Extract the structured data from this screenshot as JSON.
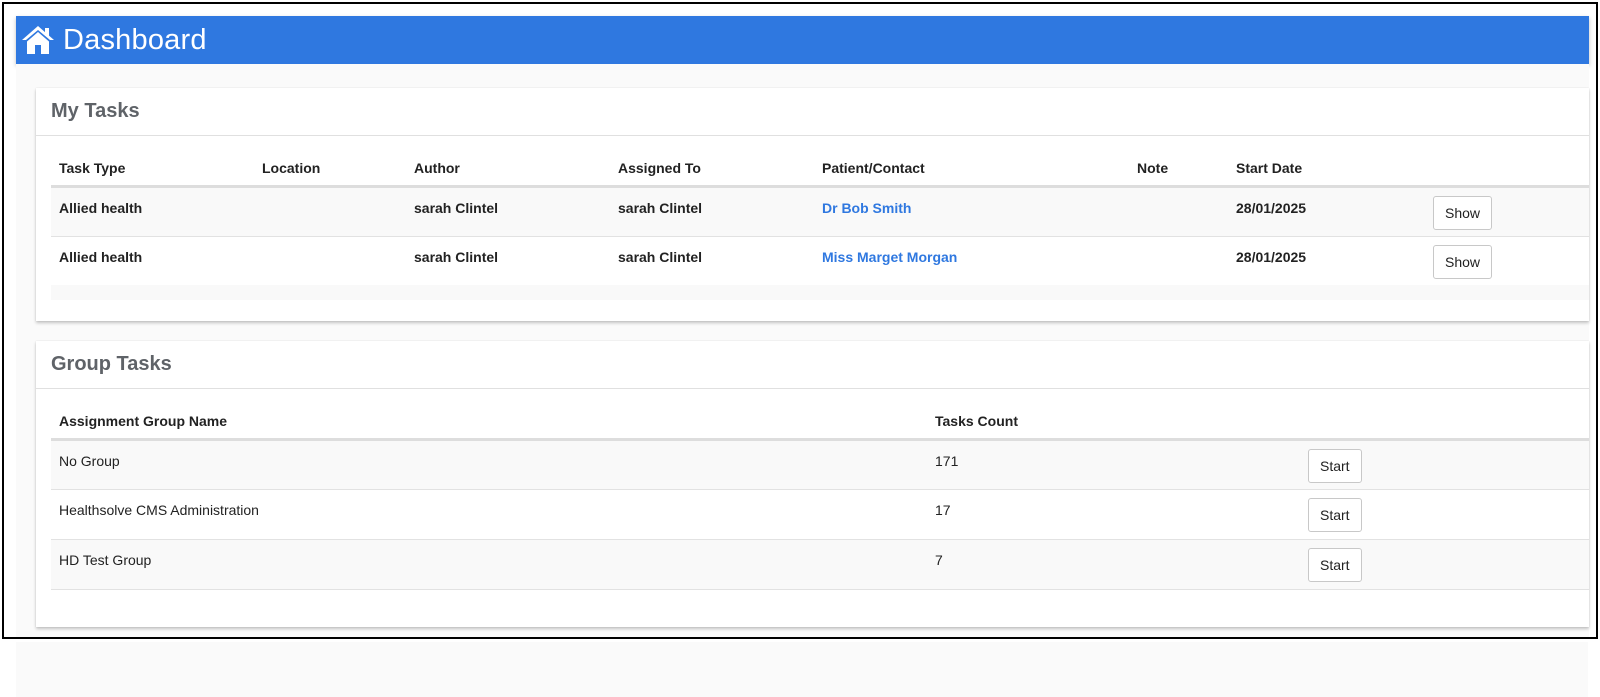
{
  "header": {
    "title": "Dashboard",
    "icon": "home-icon"
  },
  "my_tasks": {
    "title": "My Tasks",
    "columns": [
      "Task Type",
      "Location",
      "Author",
      "Assigned To",
      "Patient/Contact",
      "Note",
      "Start Date",
      ""
    ],
    "rows": [
      {
        "task_type": "Allied health",
        "location": "",
        "author": "sarah Clintel",
        "assigned_to": "sarah Clintel",
        "patient": "Dr Bob Smith",
        "note": "",
        "start_date": "28/01/2025",
        "action": "Show"
      },
      {
        "task_type": "Allied health",
        "location": "",
        "author": "sarah Clintel",
        "assigned_to": "sarah Clintel",
        "patient": "Miss Marget Morgan",
        "note": "",
        "start_date": "28/01/2025",
        "action": "Show"
      }
    ]
  },
  "group_tasks": {
    "title": "Group Tasks",
    "columns": [
      "Assignment Group Name",
      "Tasks Count",
      ""
    ],
    "rows": [
      {
        "name": "No Group",
        "count": "171",
        "action": "Start"
      },
      {
        "name": "Healthsolve CMS Administration",
        "count": "17",
        "action": "Start"
      },
      {
        "name": "HD Test Group",
        "count": "7",
        "action": "Start"
      }
    ]
  },
  "colors": {
    "accent": "#2f78e0",
    "link": "#2f78e0"
  }
}
